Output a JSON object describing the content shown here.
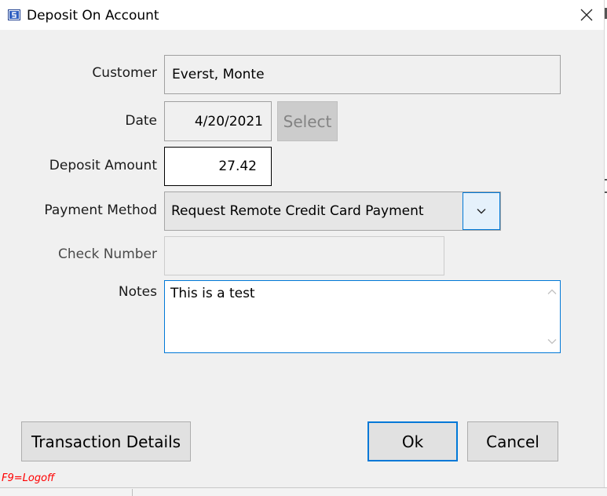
{
  "window": {
    "title": "Deposit On Account"
  },
  "form": {
    "customer_label": "Customer",
    "customer_value": "Everst, Monte",
    "date_label": "Date",
    "date_value": "4/20/2021",
    "select_label": "Select",
    "deposit_amount_label": "Deposit Amount",
    "deposit_amount_value": "27.42",
    "payment_method_label": "Payment Method",
    "payment_method_value": "Request Remote Credit Card Payment",
    "check_number_label": "Check Number",
    "check_number_value": "",
    "notes_label": "Notes",
    "notes_value": "This is a test"
  },
  "buttons": {
    "transaction_details": "Transaction Details",
    "ok": "Ok",
    "cancel": "Cancel"
  },
  "footer": {
    "hint": "F9=Logoff"
  },
  "colors": {
    "focus_border": "#0078d7",
    "hint": "#ff0000"
  },
  "icons": {
    "app": "app-icon",
    "close": "close-icon",
    "dropdown": "chevron-down-icon",
    "scroll_up": "scroll-up-icon",
    "scroll_down": "scroll-down-icon"
  }
}
